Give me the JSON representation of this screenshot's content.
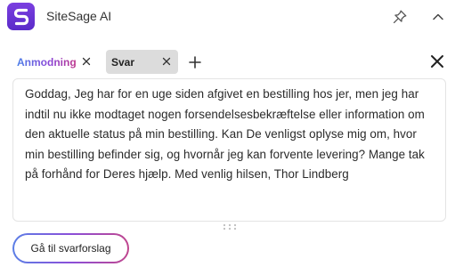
{
  "app": {
    "title": "SiteSage AI",
    "logo_letter": "S",
    "icons": {
      "pin": "pin-icon",
      "collapse": "chevron-up-icon",
      "close": "close-icon",
      "add": "plus-icon"
    }
  },
  "tabs": [
    {
      "label": "Anmodning",
      "active": false
    },
    {
      "label": "Svar",
      "active": true
    }
  ],
  "message": {
    "text": "Goddag, Jeg har for en uge siden afgivet en bestilling hos jer, men jeg har indtil nu ikke modtaget nogen forsendelsesbekræftelse eller information om den aktuelle status på min bestilling. Kan De venligst oplyse mig om, hvor min bestilling befinder sig, og hvornår jeg kan forvente levering? Mange tak på forhånd for Deres hjælp. Med venlig hilsen, Thor Lindberg"
  },
  "actions": {
    "go_to_reply_suggestion": "Gå til svarforslag"
  },
  "colors": {
    "brand_purple": "#6a35d6",
    "gradient_start": "#4a7ee8",
    "gradient_mid": "#8a45d8",
    "gradient_end": "#c0378a",
    "active_tab_bg": "#dcdcdc"
  }
}
